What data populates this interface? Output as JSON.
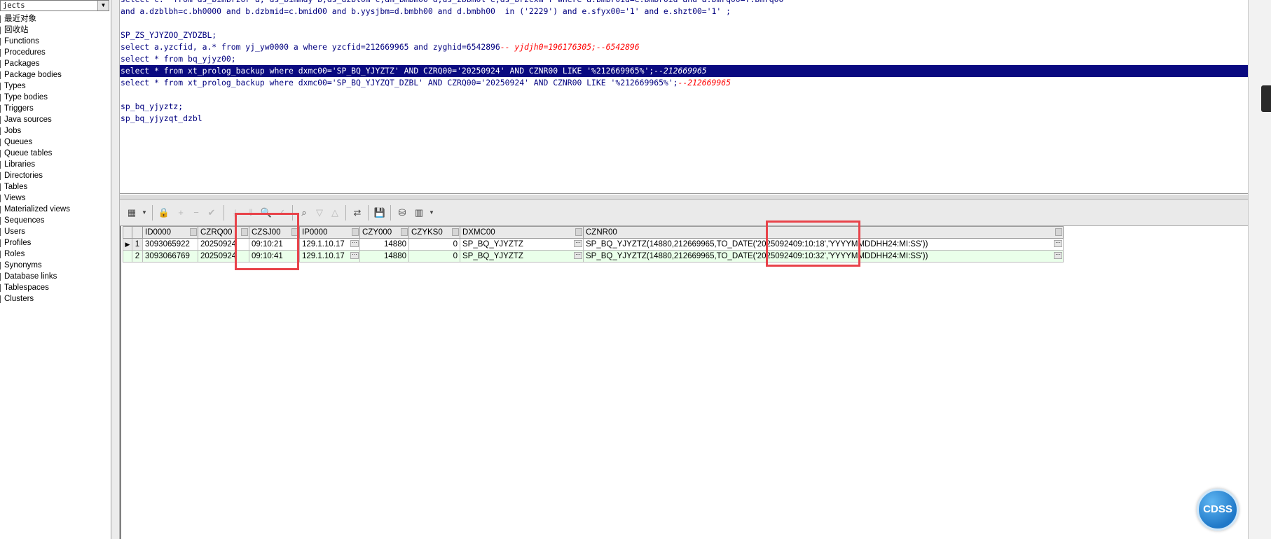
{
  "object_browser": {
    "combo_value": "jects",
    "items": [
      "最近对象",
      "回收站",
      "Functions",
      "Procedures",
      "Packages",
      "Package bodies",
      "Types",
      "Type bodies",
      "Triggers",
      "Java sources",
      "Jobs",
      "Queues",
      "Queue tables",
      "Libraries",
      "Directories",
      "Tables",
      "Views",
      "Materialized views",
      "Sequences",
      "Users",
      "Profiles",
      "Roles",
      "Synonyms",
      "Database links",
      "Tablespaces",
      "Clusters"
    ]
  },
  "editor": {
    "lines": [
      {
        "code": "select c.* from ds_bimbrzor a, ds_bimmdy b,ds_dzbl0m c,dm_bmbm00 d,ds_zbbm0l e,ds_brzcxm f where a.bmbr0id=e.bmbr0id and a.bmrq00=f.bmrq00",
        "comment": ""
      },
      {
        "code": "and a.dzblbh=c.bh0000 and b.dzbmid=c.bmid00 and b.yysjbm=d.bmbh00 and d.bmbh00  in ('2229') and e.sfyx00='1' and e.shzt00='1' ;",
        "comment": ""
      },
      {
        "code": "",
        "comment": ""
      },
      {
        "code": "SP_ZS_YJYZOO_ZYDZBL;",
        "comment": ""
      },
      {
        "code": "select a.yzcfid, a.* from yj_yw0000 a where yzcfid=212669965 and zyghid=6542896",
        "comment": "-- yjdjh0=196176305;--6542896"
      },
      {
        "code": "select * from bq_yjyz00;",
        "comment": ""
      },
      {
        "code": "select * from xt_prolog_backup where dxmc00='SP_BQ_YJYZTZ' AND CZRQ00='20250924' AND CZNR00 LIKE '%212669965%';",
        "comment": "--212669965"
      },
      {
        "code": "select * from xt_prolog_backup where dxmc00='SP_BQ_YJYZQT_DZBL' AND CZRQ00='20250924' AND CZNR00 LIKE '%212669965%';",
        "comment": "--212669965"
      },
      {
        "code": "",
        "comment": ""
      },
      {
        "code": "sp_bq_yjyztz;",
        "comment": ""
      },
      {
        "code": "sp_bq_yjyzqt_dzbl",
        "comment": ""
      }
    ],
    "selected_line": 6
  },
  "grid": {
    "columns": [
      "ID0000",
      "CZRQ00",
      "CZSJ00",
      "IP0000",
      "CZY000",
      "CZYKS0",
      "DXMC00",
      "CZNR00"
    ],
    "rows": [
      {
        "num": "1",
        "id": "3093065922",
        "czrq": "20250924",
        "czsj": "09:10:21",
        "ip": "129.1.10.17",
        "czy": "14880",
        "czyks": "0",
        "dxmc": "SP_BQ_YJYZTZ",
        "cznr": "SP_BQ_YJYZTZ(14880,212669965,TO_DATE('2025092409:10:18','YYYYMMDDHH24:MI:SS'))"
      },
      {
        "num": "2",
        "id": "3093066769",
        "czrq": "20250924",
        "czsj": "09:10:41",
        "ip": "129.1.10.17",
        "czy": "14880",
        "czyks": "0",
        "dxmc": "SP_BQ_YJYZTZ",
        "cznr": "SP_BQ_YJYZTZ(14880,212669965,TO_DATE('2025092409:10:32','YYYYMMDDHH24:MI:SS'))"
      }
    ]
  },
  "badge": {
    "label": "CDSS"
  },
  "colors": {
    "selection": "#0a0a80",
    "highlight_box": "#e8434a",
    "alt_row": "#eaffea",
    "sql_keyword": "#00007f",
    "comment": "#ff0000"
  }
}
